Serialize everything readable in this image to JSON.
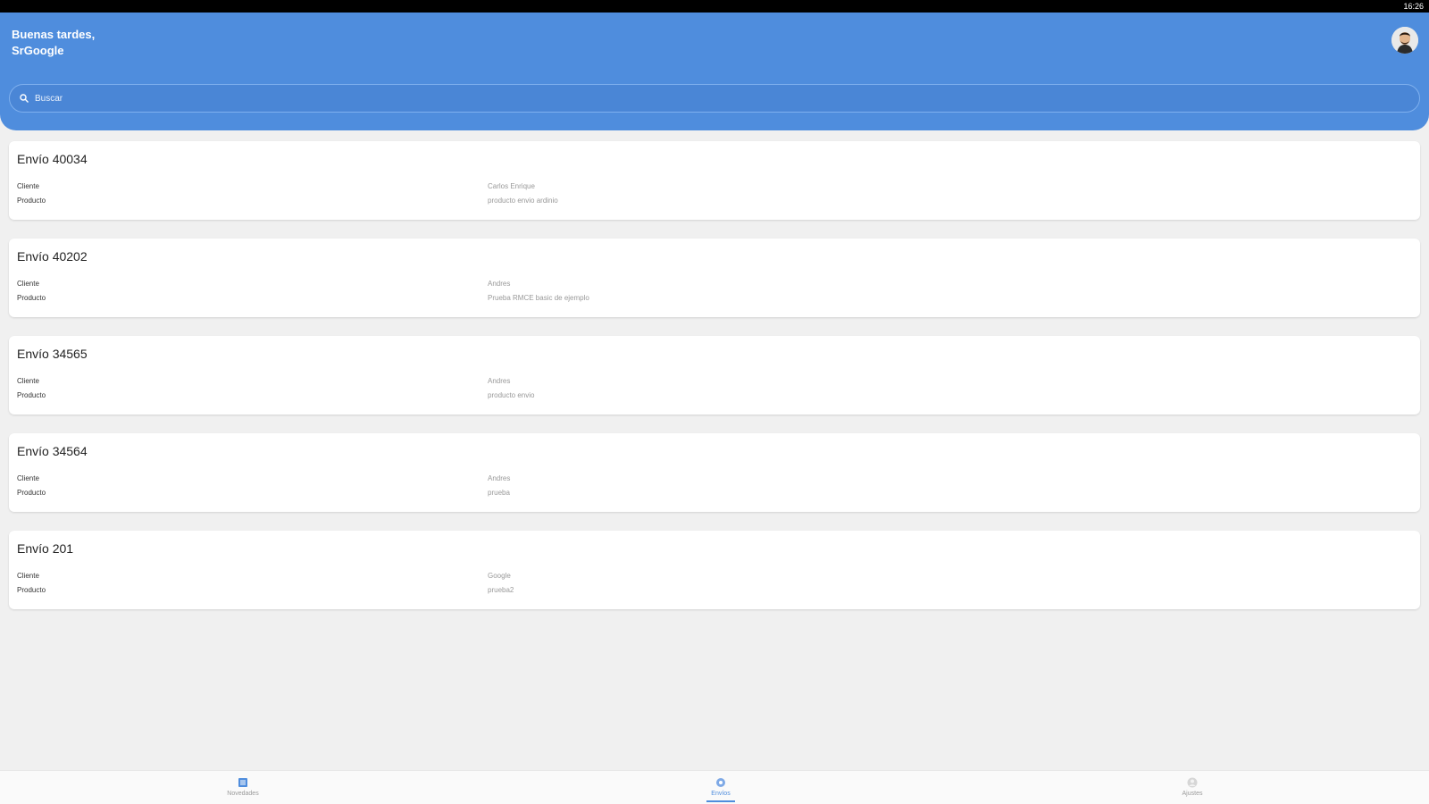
{
  "status_bar": {
    "time": "16:26"
  },
  "header": {
    "greeting_line1": "Buenas tardes,",
    "greeting_line2": "SrGoogle"
  },
  "search": {
    "placeholder": "Buscar",
    "icon": "search-icon"
  },
  "shipments": [
    {
      "title": "Envío 40034",
      "client_label": "Cliente",
      "client": "Carlos Enrique",
      "product_label": "Producto",
      "product": "producto envio ardinio"
    },
    {
      "title": "Envío 40202",
      "client_label": "Cliente",
      "client": "Andres",
      "product_label": "Producto",
      "product": "Prueba RMCE basic de ejemplo"
    },
    {
      "title": "Envío 34565",
      "client_label": "Cliente",
      "client": "Andres",
      "product_label": "Producto",
      "product": "producto envio"
    },
    {
      "title": "Envío 34564",
      "client_label": "Cliente",
      "client": "Andres",
      "product_label": "Producto",
      "product": "prueba"
    },
    {
      "title": "Envío 201",
      "client_label": "Cliente",
      "client": "Google",
      "product_label": "Producto",
      "product": "prueba2"
    }
  ],
  "bottom_nav": [
    {
      "label": "Novedades",
      "icon": "list-icon"
    },
    {
      "label": "Envíos",
      "icon": "location-icon"
    },
    {
      "label": "Ajustes",
      "icon": "user-icon"
    }
  ],
  "colors": {
    "primary": "#4f8ddd",
    "background": "#f0f0f0",
    "card": "#ffffff"
  }
}
